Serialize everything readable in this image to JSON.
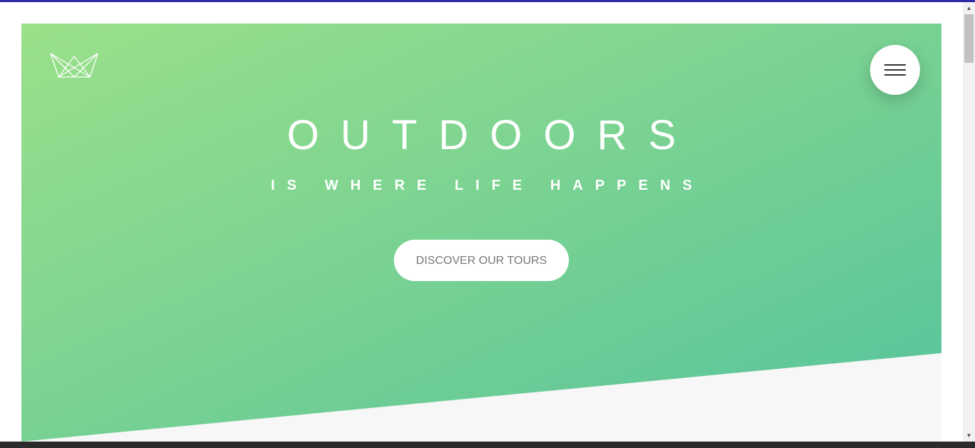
{
  "colors": {
    "top_accent": "#2f2aa6",
    "hero_gradient_start": "#9be08a",
    "hero_gradient_end": "#55c39c",
    "page_background": "#f7f7f7"
  },
  "logo": {
    "icon": "crown-icon"
  },
  "menu": {
    "icon": "hamburger-icon"
  },
  "hero": {
    "title": "OUTDOORS",
    "subtitle": "IS WHERE LIFE HAPPENS",
    "cta_label": "DISCOVER OUR TOURS"
  },
  "scrollbar": {
    "up_arrow": "▲",
    "down_arrow": "▼"
  }
}
